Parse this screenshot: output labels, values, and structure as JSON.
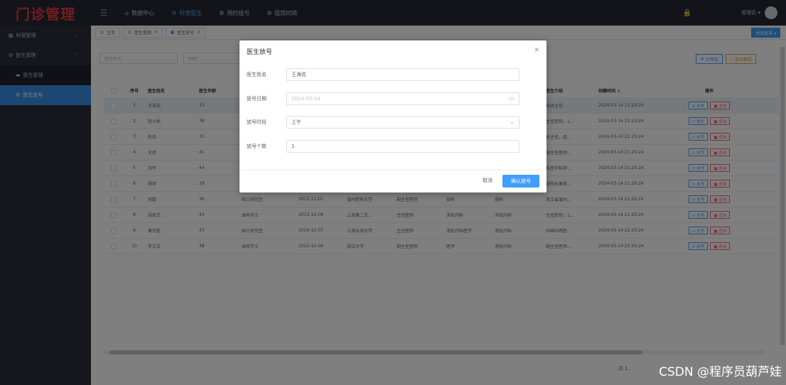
{
  "header": {
    "logo": "门诊管理",
    "nav": [
      {
        "icon": "home-icon",
        "label": "数据中心"
      },
      {
        "icon": "gear-icon",
        "label": "科室医生"
      },
      {
        "icon": "gear-icon",
        "label": "预约挂号"
      },
      {
        "icon": "gear-icon",
        "label": "医院时政"
      }
    ],
    "active_nav": "科室医生",
    "user": "管理员 ▾"
  },
  "sidebar": {
    "items": [
      {
        "label": "科室管理",
        "chevron": "⌄"
      },
      {
        "label": "医生管理",
        "chevron": "⌃"
      },
      {
        "label": "医生管理"
      },
      {
        "label": "医生放号"
      }
    ]
  },
  "tabs": {
    "items": [
      "主页",
      "医生管理",
      "医生放号"
    ],
    "close_menu": "关闭菜单 ▾"
  },
  "search": {
    "name_placeholder": "医生姓名",
    "dept_placeholder": "职称"
  },
  "toolbar": {
    "filter": "列筛选",
    "tutorial": "使用教程"
  },
  "table": {
    "headers": [
      "序号",
      "医生姓名",
      "医生年龄",
      "",
      "",
      "",
      "",
      "",
      "",
      "医生介绍",
      "创建时间 ↓",
      "操作"
    ],
    "ops": [
      "☑ 放号",
      "■ 查询"
    ],
    "rows": [
      [
        "1",
        "王海花",
        "33",
        "",
        "",
        "",
        "",
        "",
        "",
        "科研主任...",
        "2024-03-14 21:20:24"
      ],
      [
        "2",
        "阮士秋",
        "38",
        "",
        "",
        "",
        "",
        "",
        "",
        "主任医师。1...",
        "2024-03-14 21:20:24"
      ],
      [
        "3",
        "陈伟",
        "31",
        "",
        "",
        "",
        "",
        "",
        "",
        "科主任，组...",
        "2024-03-14 21:20:24"
      ],
      [
        "4",
        "王琼",
        "41",
        "",
        "",
        "",
        "",
        "",
        "",
        "副主任医师...",
        "2024-03-14 21:20:24"
      ],
      [
        "5",
        "刘平",
        "44",
        "",
        "",
        "",
        "",
        "",
        "",
        "科室学科带...",
        "2024-03-14 21:20:24"
      ],
      [
        "6",
        "杨李",
        "39",
        "",
        "",
        "",
        "",
        "",
        "",
        "副院长兼骨...",
        "2024-03-14 21:20:24"
      ],
      [
        "7",
        "何磊",
        "36",
        "硕士研究生",
        "2015-12-01",
        "温州医科大学",
        "副主任医师",
        "骨科",
        "骨科",
        "浙江省温州...",
        "2024-03-14 21:20:24"
      ],
      [
        "8",
        "张凯杰",
        "45",
        "本科学士",
        "2013-12-09",
        "上海第二军...",
        "主任医师",
        "消化内科",
        "消化内科",
        "主任医师。1...",
        "2024-03-14 21:20:24"
      ],
      [
        "9",
        "章司花",
        "37",
        "硕士研究生",
        "2016-12-07",
        "上海长海大学",
        "主任医师",
        "消化内科医学",
        "消化内科",
        "中国中西医...",
        "2024-03-14 21:20:24"
      ],
      [
        "10",
        "罗文文",
        "38",
        "本科学士",
        "2015-12-09",
        "浙江大学",
        "副主任医师",
        "医学",
        "消化内科",
        "副主任医师...",
        "2024-03-14 21:20:24"
      ]
    ]
  },
  "pager": {
    "total": "共 1"
  },
  "dialog": {
    "title": "医生放号",
    "fields": [
      {
        "label": "医生姓名",
        "value": "王海花"
      },
      {
        "label": "放号日期",
        "value": "2024-03-14"
      },
      {
        "label": "放号时段",
        "value": "上午"
      },
      {
        "label": "放号个数",
        "value": "1"
      }
    ],
    "cancel": "取消",
    "confirm": "确认放号"
  },
  "watermark": "CSDN @程序员葫芦娃"
}
